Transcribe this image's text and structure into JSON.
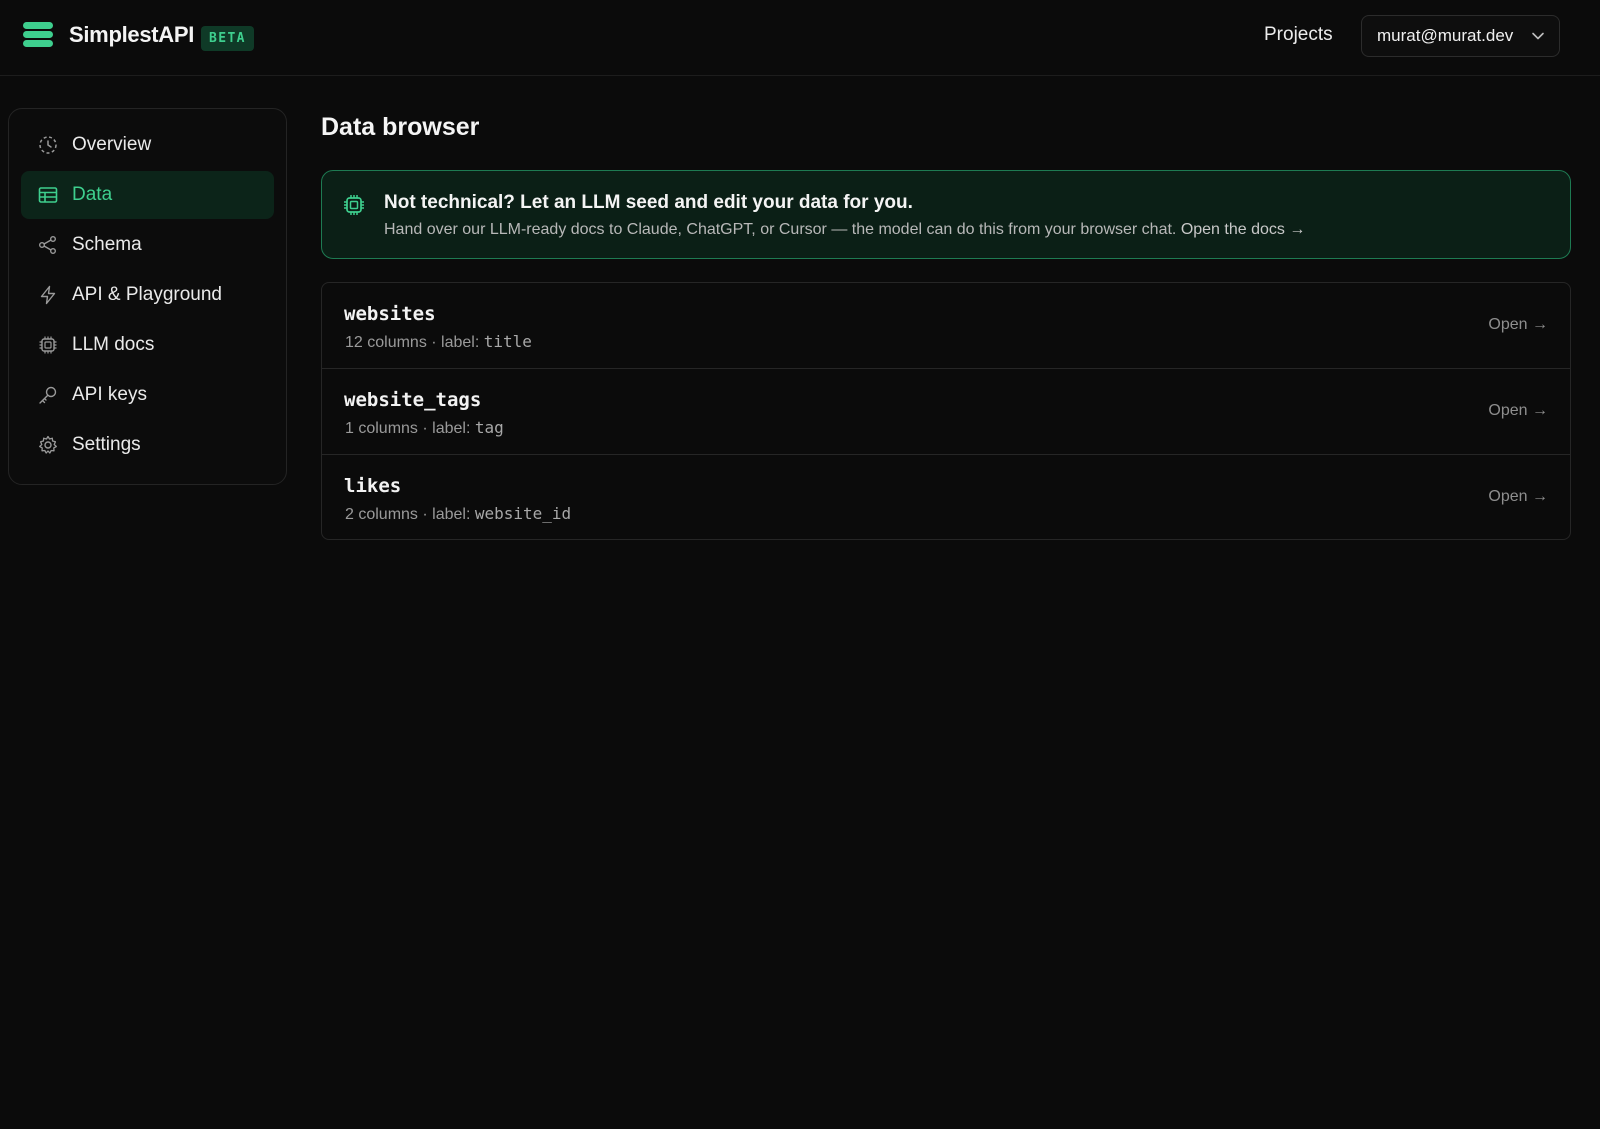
{
  "header": {
    "brand": "SimplestAPI",
    "badge": "BETA",
    "projects_link": "Projects",
    "account_email": "murat@murat.dev"
  },
  "sidebar": {
    "items": [
      {
        "label": "Overview",
        "icon": "overview-icon",
        "active": false
      },
      {
        "label": "Data",
        "icon": "table-icon",
        "active": true
      },
      {
        "label": "Schema",
        "icon": "share-nodes-icon",
        "active": false
      },
      {
        "label": "API & Playground",
        "icon": "lightning-icon",
        "active": false
      },
      {
        "label": "LLM docs",
        "icon": "chip-icon",
        "active": false
      },
      {
        "label": "API keys",
        "icon": "key-icon",
        "active": false
      },
      {
        "label": "Settings",
        "icon": "gear-icon",
        "active": false
      }
    ]
  },
  "main": {
    "title": "Data browser",
    "banner": {
      "title": "Not technical? Let an LLM seed and edit your data for you.",
      "text": "Hand over our LLM-ready docs to Claude, ChatGPT, or Cursor — the model can do this from your browser chat.",
      "link": "Open the docs →"
    },
    "tables": [
      {
        "name": "websites",
        "columns": "12 columns · label: ",
        "label": "title",
        "action": "Open →"
      },
      {
        "name": "website_tags",
        "columns": "1 columns · label: ",
        "label": "tag",
        "action": "Open →"
      },
      {
        "name": "likes",
        "columns": "2 columns · label: ",
        "label": "website_id",
        "action": "Open →"
      }
    ]
  },
  "colors": {
    "accent": "#3ecf8e",
    "background": "#0b0b0b",
    "active_nav": "#0c2419",
    "banner_border": "#1e7a52"
  }
}
